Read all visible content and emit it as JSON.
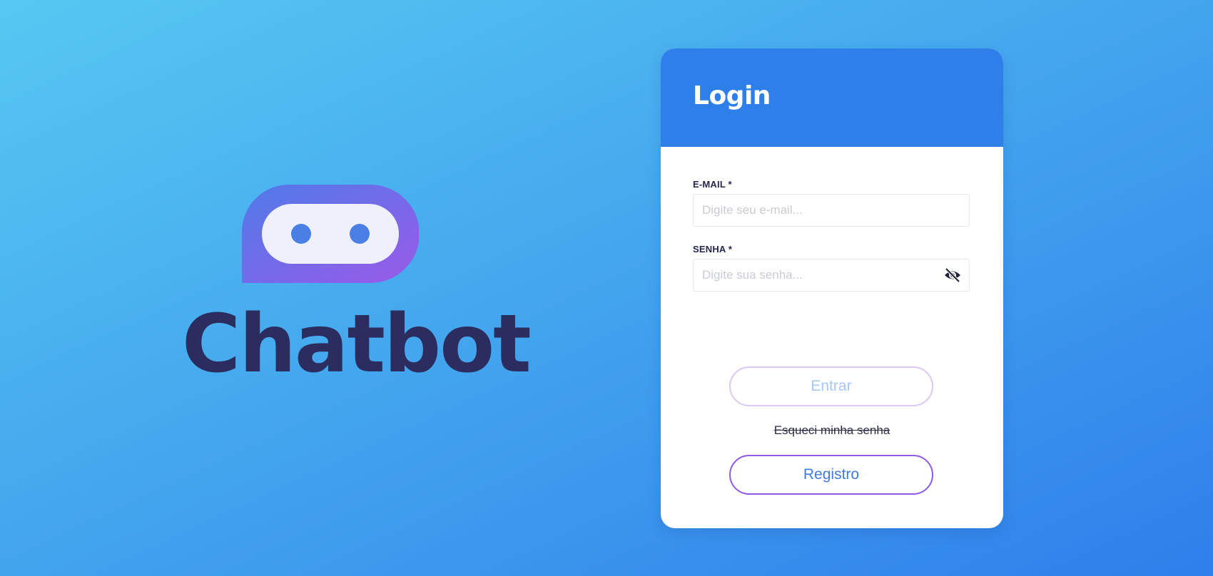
{
  "brand": {
    "name": "Chatbot",
    "logo_icon": "robot-face-chat-bubble-icon"
  },
  "login": {
    "title": "Login",
    "email": {
      "label": "E-MAIL *",
      "placeholder": "Digite seu e-mail...",
      "value": ""
    },
    "password": {
      "label": "SENHA *",
      "placeholder": "Digite sua senha...",
      "value": "",
      "toggle_icon": "eye-off-icon"
    },
    "enter_label": "Entrar",
    "forgot_label": "Esqueci minha senha",
    "register_label": "Registro"
  },
  "colors": {
    "background_start": "#56c8f2",
    "background_end": "#2f7feb",
    "header": "#2f7fea",
    "brand_text": "#2a2d5e",
    "logo_gradient_start": "#4f7be8",
    "logo_gradient_end": "#9a5ae8",
    "register_border": "#8e5ae6",
    "enter_border": "#d9c9f3"
  }
}
